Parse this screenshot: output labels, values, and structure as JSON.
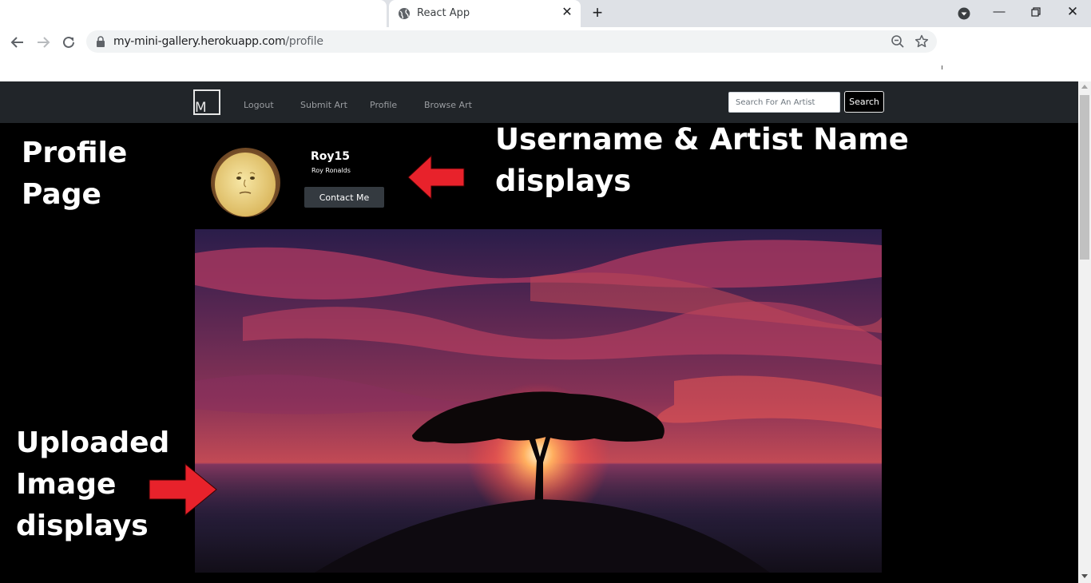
{
  "browser": {
    "tab_title": "React App",
    "url_host": "my-mini-gallery.herokuapp.com",
    "url_path": "/profile"
  },
  "navbar": {
    "brand": "M",
    "links": [
      "Logout",
      "Submit Art",
      "Profile",
      "Browse Art"
    ],
    "search_placeholder": "Search For An Artist",
    "search_button": "Search"
  },
  "profile": {
    "username": "Roy15",
    "artist_name": "Roy Ronalds",
    "contact_button": "Contact Me"
  },
  "annotations": {
    "profile_page": "Profile\nPage",
    "username_artist": "Username & Artist Name\ndisplays",
    "uploaded_image": "Uploaded\nImage\ndisplays"
  },
  "colors": {
    "navbar_bg": "#212529",
    "page_bg": "#000000",
    "annotation_arrow": "#e8222b"
  },
  "icons": {
    "tab_favicon": "globe-icon",
    "back": "arrow-left-icon",
    "forward": "arrow-right-icon",
    "reload": "reload-icon",
    "lock": "lock-icon",
    "zoom": "zoom-out-icon",
    "bookmark": "star-icon"
  }
}
